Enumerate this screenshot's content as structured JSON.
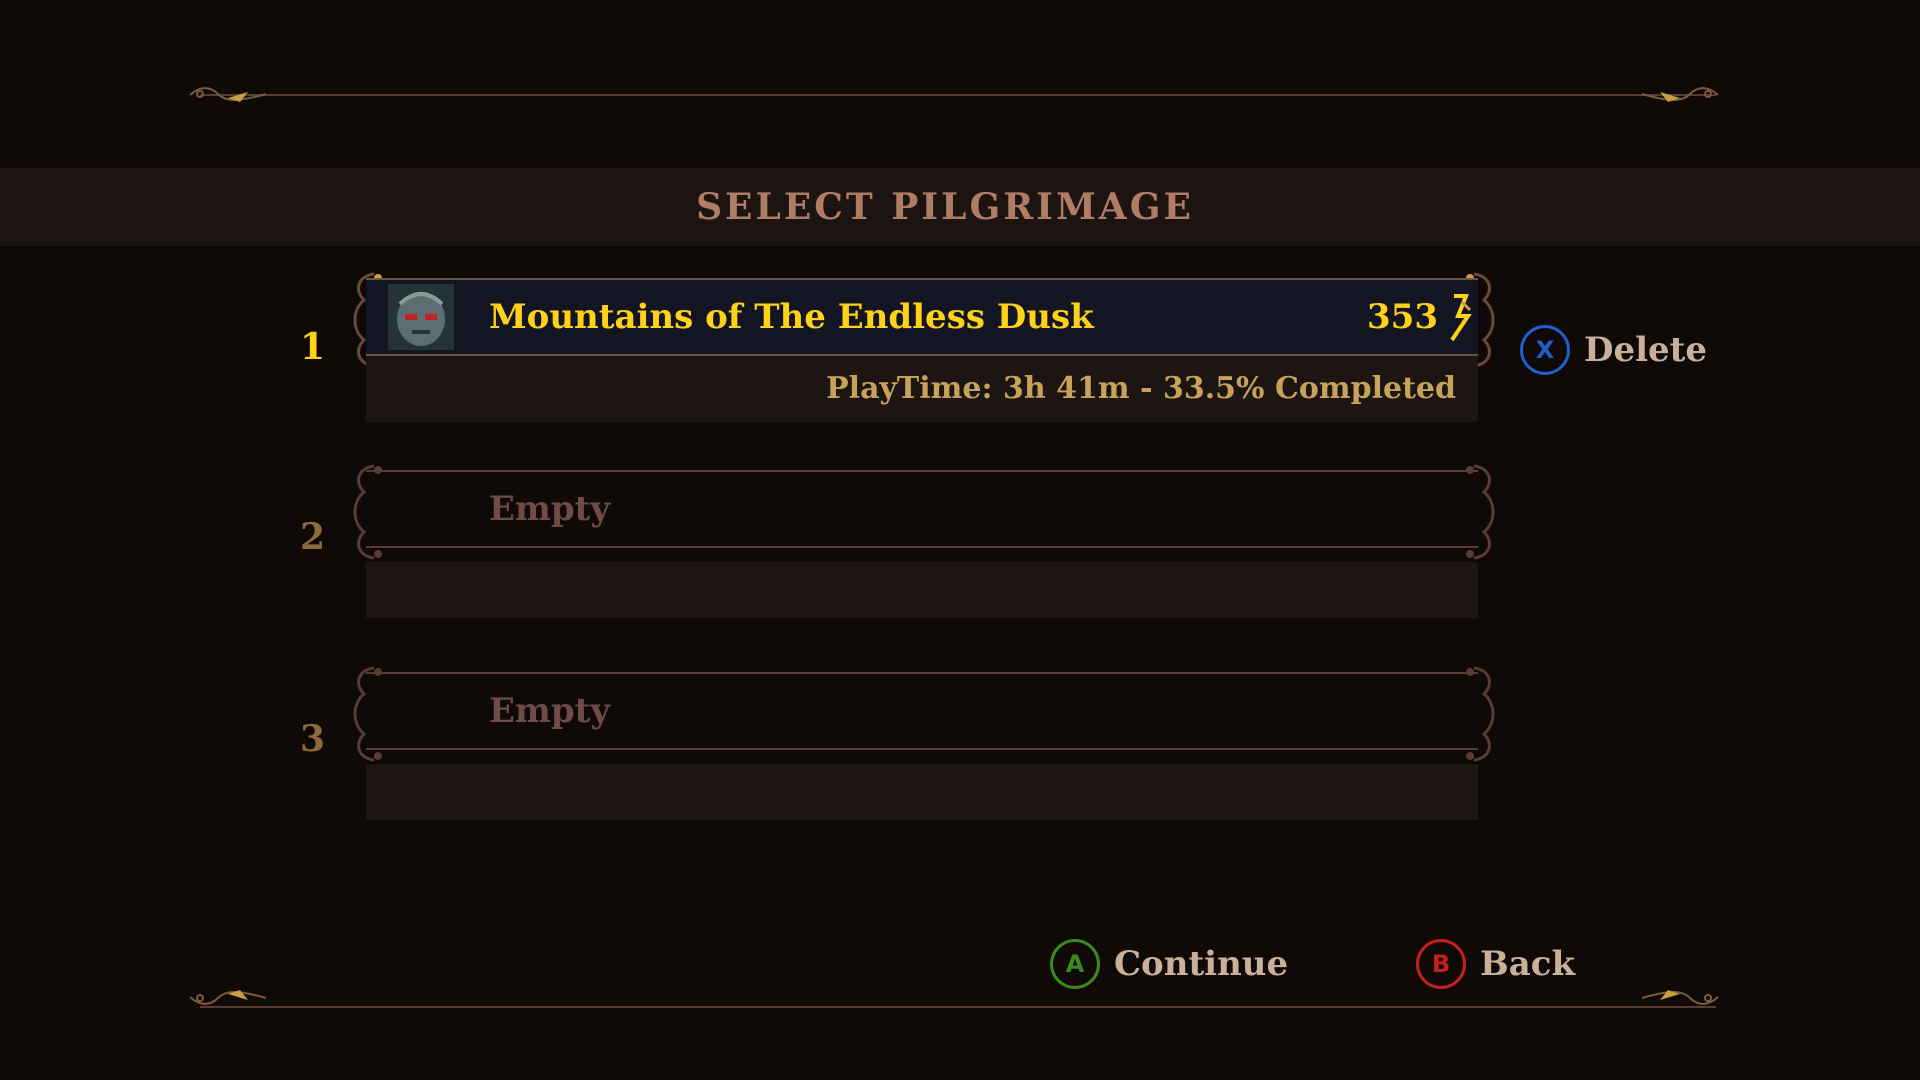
{
  "header": {
    "title": "SELECT PILGRIMAGE"
  },
  "slots": [
    {
      "number": "1",
      "name": "Mountains of The Endless Dusk",
      "score": "353",
      "playtime": "PlayTime: 3h 41m - 33.5% Completed",
      "state": "filled",
      "icons": {
        "avatar": "penitent-mask-icon",
        "currency": "tears-of-atonement-icon"
      }
    },
    {
      "number": "2",
      "name": "Empty",
      "state": "empty"
    },
    {
      "number": "3",
      "name": "Empty",
      "state": "empty"
    }
  ],
  "prompts": {
    "delete": {
      "glyph": "X",
      "label": "Delete",
      "color": "#1f5fcf"
    },
    "continue": {
      "glyph": "A",
      "label": "Continue",
      "color": "#3c8a1f"
    },
    "back": {
      "glyph": "B",
      "label": "Back",
      "color": "#c4201f"
    }
  },
  "colors": {
    "accent_gold": "#ffd21a",
    "muted_text": "#6e4c45",
    "background": "#0f0907"
  }
}
